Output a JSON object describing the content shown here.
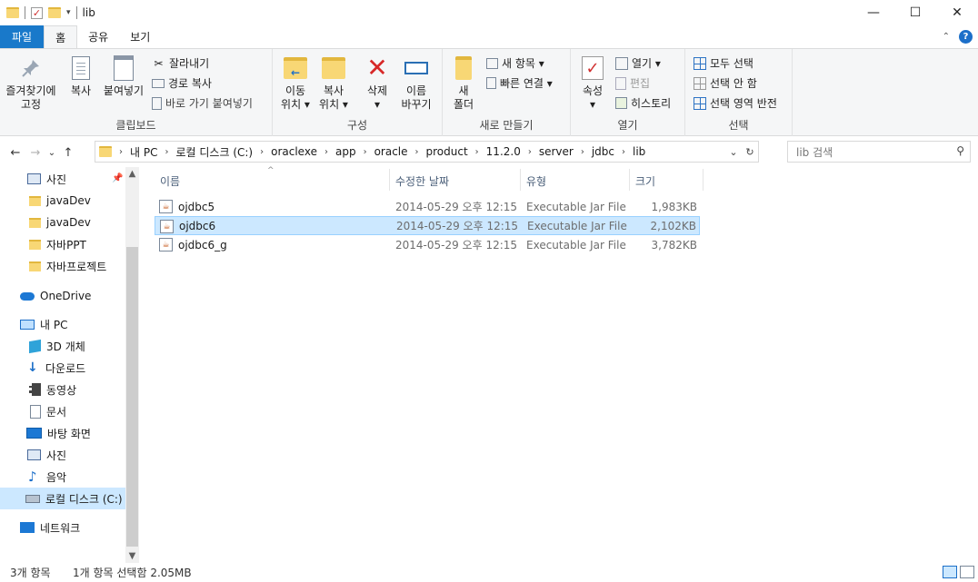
{
  "window": {
    "title": "lib"
  },
  "window_controls": {
    "minimize": "—",
    "maximize": "☐",
    "close": "✕"
  },
  "ribbon_tabs": [
    "파일",
    "홈",
    "공유",
    "보기"
  ],
  "ribbon": {
    "clipboard": {
      "label": "클립보드",
      "pin": "즐겨찾기에\n고정",
      "copy": "복사",
      "paste": "붙여넣기",
      "cut": "잘라내기",
      "copy_path": "경로 복사",
      "paste_shortcut": "바로 가기 붙여넣기"
    },
    "organize": {
      "label": "구성",
      "move_to": "이동\n위치 ▾",
      "copy_to": "복사\n위치 ▾",
      "delete": "삭제\n▾",
      "rename": "이름\n바꾸기"
    },
    "new": {
      "label": "새로 만들기",
      "new_folder": "새\n폴더",
      "new_item": "새 항목 ▾",
      "easy_access": "빠른 연결 ▾"
    },
    "open": {
      "label": "열기",
      "properties": "속성\n▾",
      "open": "열기 ▾",
      "edit": "편집",
      "history": "히스토리"
    },
    "select": {
      "label": "선택",
      "select_all": "모두 선택",
      "select_none": "선택 안 함",
      "invert": "선택 영역 반전"
    }
  },
  "nav_buttons": {
    "back": "←",
    "forward": "→",
    "recent": "⌄",
    "up": "↑"
  },
  "breadcrumb": [
    "내 PC",
    "로컬 디스크 (C:)",
    "oraclexe",
    "app",
    "oracle",
    "product",
    "11.2.0",
    "server",
    "jdbc",
    "lib"
  ],
  "search": {
    "placeholder": "lib 검색"
  },
  "nav_pane": [
    {
      "label": "사진",
      "icon": "pictures-icon",
      "pinned": true
    },
    {
      "label": "javaDev",
      "icon": "folder-icon"
    },
    {
      "label": "javaDev",
      "icon": "folder-icon"
    },
    {
      "label": "자바PPT",
      "icon": "folder-icon"
    },
    {
      "label": "자바프로젝트",
      "icon": "folder-icon"
    },
    {
      "label": "OneDrive",
      "icon": "cloud-icon"
    },
    {
      "label": "내 PC",
      "icon": "computer-icon"
    },
    {
      "label": "3D 개체",
      "icon": "cube-icon"
    },
    {
      "label": "다운로드",
      "icon": "download-icon"
    },
    {
      "label": "동영상",
      "icon": "video-icon"
    },
    {
      "label": "문서",
      "icon": "document-icon"
    },
    {
      "label": "바탕 화면",
      "icon": "desktop-icon"
    },
    {
      "label": "사진",
      "icon": "pictures-icon"
    },
    {
      "label": "음악",
      "icon": "music-icon"
    },
    {
      "label": "로컬 디스크 (C:)",
      "icon": "drive-icon",
      "selected": true
    },
    {
      "label": "네트워크",
      "icon": "network-icon"
    }
  ],
  "columns": {
    "name": "이름",
    "date": "수정한 날짜",
    "type": "유형",
    "size": "크기"
  },
  "files": [
    {
      "name": "ojdbc5",
      "date": "2014-05-29 오후 12:15",
      "type": "Executable Jar File",
      "size": "1,983KB"
    },
    {
      "name": "ojdbc6",
      "date": "2014-05-29 오후 12:15",
      "type": "Executable Jar File",
      "size": "2,102KB",
      "selected": true
    },
    {
      "name": "ojdbc6_g",
      "date": "2014-05-29 오후 12:15",
      "type": "Executable Jar File",
      "size": "3,782KB"
    }
  ],
  "status": {
    "item_count": "3개 항목",
    "selection": "1개 항목 선택함 2.05MB"
  },
  "colors": {
    "file_tab": "#1979ca",
    "selection": "#cce8ff",
    "folder": "#f8d775"
  }
}
